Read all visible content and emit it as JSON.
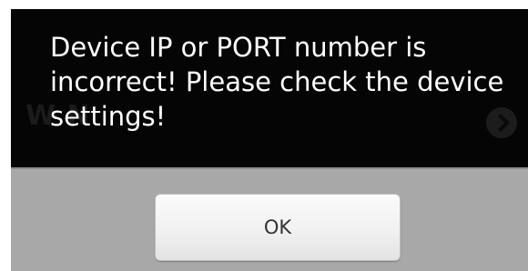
{
  "dialog": {
    "message": "Device IP or PORT number is incorrect! Please check the device settings!",
    "ok_label": "OK"
  },
  "background": {
    "partial_title": "W                              N"
  },
  "colors": {
    "message_panel": "#050505",
    "button_area": "#a9a8a8",
    "message_text": "#ffffff"
  }
}
